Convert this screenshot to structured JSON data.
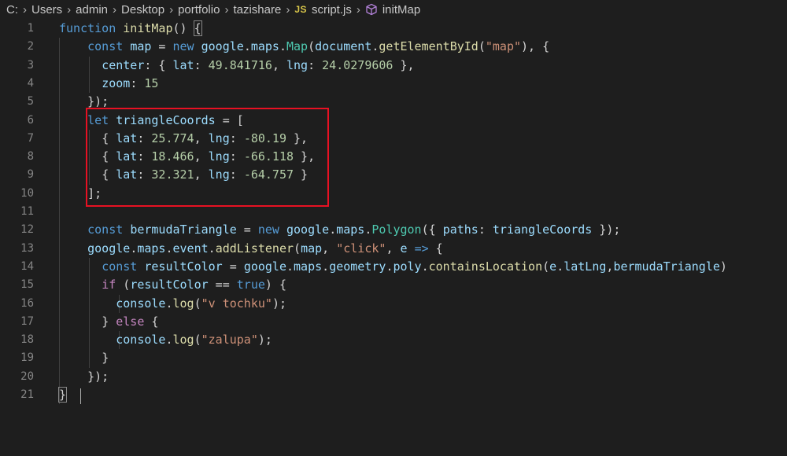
{
  "breadcrumb": {
    "items": [
      "C:",
      "Users",
      "admin",
      "Desktop",
      "portfolio",
      "tazishare"
    ],
    "file_icon": "JS",
    "file": "script.js",
    "symbol": "initMap"
  },
  "lines": [
    {
      "n": "1"
    },
    {
      "n": "2"
    },
    {
      "n": "3"
    },
    {
      "n": "4"
    },
    {
      "n": "5"
    },
    {
      "n": "6"
    },
    {
      "n": "7"
    },
    {
      "n": "8"
    },
    {
      "n": "9"
    },
    {
      "n": "10"
    },
    {
      "n": "11"
    },
    {
      "n": "12"
    },
    {
      "n": "13"
    },
    {
      "n": "14"
    },
    {
      "n": "15"
    },
    {
      "n": "16"
    },
    {
      "n": "17"
    },
    {
      "n": "18"
    },
    {
      "n": "19"
    },
    {
      "n": "20"
    },
    {
      "n": "21"
    }
  ],
  "code": [
    [
      [
        "function",
        "kw-blue"
      ],
      [
        " ",
        "punc"
      ],
      [
        "initMap",
        "fn"
      ],
      [
        "() ",
        "punc"
      ],
      [
        "{",
        "punc bracket-match"
      ]
    ],
    [
      [
        "    ",
        "punc"
      ],
      [
        "const",
        "kw-blue"
      ],
      [
        " ",
        "punc"
      ],
      [
        "map",
        "var"
      ],
      [
        " = ",
        "punc"
      ],
      [
        "new",
        "kw-blue"
      ],
      [
        " ",
        "punc"
      ],
      [
        "google",
        "var"
      ],
      [
        ".",
        "punc"
      ],
      [
        "maps",
        "var"
      ],
      [
        ".",
        "punc"
      ],
      [
        "Map",
        "cls"
      ],
      [
        "(",
        "punc"
      ],
      [
        "document",
        "var"
      ],
      [
        ".",
        "punc"
      ],
      [
        "getElementById",
        "fn"
      ],
      [
        "(",
        "punc"
      ],
      [
        "\"map\"",
        "str"
      ],
      [
        "), {",
        "punc"
      ]
    ],
    [
      [
        "      ",
        "punc"
      ],
      [
        "center",
        "var"
      ],
      [
        ": { ",
        "punc"
      ],
      [
        "lat",
        "var"
      ],
      [
        ": ",
        "punc"
      ],
      [
        "49.841716",
        "num"
      ],
      [
        ", ",
        "punc"
      ],
      [
        "lng",
        "var"
      ],
      [
        ": ",
        "punc"
      ],
      [
        "24.0279606",
        "num"
      ],
      [
        " },",
        "punc"
      ]
    ],
    [
      [
        "      ",
        "punc"
      ],
      [
        "zoom",
        "var"
      ],
      [
        ": ",
        "punc"
      ],
      [
        "15",
        "num"
      ]
    ],
    [
      [
        "    ",
        "punc"
      ],
      [
        "});",
        "punc"
      ]
    ],
    [
      [
        "    ",
        "punc"
      ],
      [
        "let",
        "kw-blue"
      ],
      [
        " ",
        "punc"
      ],
      [
        "triangleCoords",
        "var"
      ],
      [
        " = [",
        "punc"
      ]
    ],
    [
      [
        "      ",
        "punc"
      ],
      [
        "{ ",
        "punc"
      ],
      [
        "lat",
        "var"
      ],
      [
        ": ",
        "punc"
      ],
      [
        "25.774",
        "num"
      ],
      [
        ", ",
        "punc"
      ],
      [
        "lng",
        "var"
      ],
      [
        ": ",
        "punc"
      ],
      [
        "-80.19",
        "num"
      ],
      [
        " },",
        "punc"
      ]
    ],
    [
      [
        "      ",
        "punc"
      ],
      [
        "{ ",
        "punc"
      ],
      [
        "lat",
        "var"
      ],
      [
        ": ",
        "punc"
      ],
      [
        "18.466",
        "num"
      ],
      [
        ", ",
        "punc"
      ],
      [
        "lng",
        "var"
      ],
      [
        ": ",
        "punc"
      ],
      [
        "-66.118",
        "num"
      ],
      [
        " },",
        "punc"
      ]
    ],
    [
      [
        "      ",
        "punc"
      ],
      [
        "{ ",
        "punc"
      ],
      [
        "lat",
        "var"
      ],
      [
        ": ",
        "punc"
      ],
      [
        "32.321",
        "num"
      ],
      [
        ", ",
        "punc"
      ],
      [
        "lng",
        "var"
      ],
      [
        ": ",
        "punc"
      ],
      [
        "-64.757",
        "num"
      ],
      [
        " }",
        "punc"
      ]
    ],
    [
      [
        "    ",
        "punc"
      ],
      [
        "];",
        "punc"
      ]
    ],
    [],
    [
      [
        "    ",
        "punc"
      ],
      [
        "const",
        "kw-blue"
      ],
      [
        " ",
        "punc"
      ],
      [
        "bermudaTriangle",
        "var"
      ],
      [
        " = ",
        "punc"
      ],
      [
        "new",
        "kw-blue"
      ],
      [
        " ",
        "punc"
      ],
      [
        "google",
        "var"
      ],
      [
        ".",
        "punc"
      ],
      [
        "maps",
        "var"
      ],
      [
        ".",
        "punc"
      ],
      [
        "Polygon",
        "cls"
      ],
      [
        "({ ",
        "punc"
      ],
      [
        "paths",
        "var"
      ],
      [
        ": ",
        "punc"
      ],
      [
        "triangleCoords",
        "var"
      ],
      [
        " });",
        "punc"
      ]
    ],
    [
      [
        "    ",
        "punc"
      ],
      [
        "google",
        "var"
      ],
      [
        ".",
        "punc"
      ],
      [
        "maps",
        "var"
      ],
      [
        ".",
        "punc"
      ],
      [
        "event",
        "var"
      ],
      [
        ".",
        "punc"
      ],
      [
        "addListener",
        "fn"
      ],
      [
        "(",
        "punc"
      ],
      [
        "map",
        "var"
      ],
      [
        ", ",
        "punc"
      ],
      [
        "\"click\"",
        "str"
      ],
      [
        ", ",
        "punc"
      ],
      [
        "e",
        "var"
      ],
      [
        " ",
        "punc"
      ],
      [
        "=>",
        "kw-blue"
      ],
      [
        " {",
        "punc"
      ]
    ],
    [
      [
        "      ",
        "punc"
      ],
      [
        "const",
        "kw-blue"
      ],
      [
        " ",
        "punc"
      ],
      [
        "resultColor",
        "var"
      ],
      [
        " = ",
        "punc"
      ],
      [
        "google",
        "var"
      ],
      [
        ".",
        "punc"
      ],
      [
        "maps",
        "var"
      ],
      [
        ".",
        "punc"
      ],
      [
        "geometry",
        "var"
      ],
      [
        ".",
        "punc"
      ],
      [
        "poly",
        "var"
      ],
      [
        ".",
        "punc"
      ],
      [
        "containsLocation",
        "fn"
      ],
      [
        "(",
        "punc"
      ],
      [
        "e",
        "var"
      ],
      [
        ".",
        "punc"
      ],
      [
        "latLng",
        "var"
      ],
      [
        ",",
        "punc"
      ],
      [
        "bermudaTriangle",
        "var"
      ],
      [
        ")",
        "punc"
      ]
    ],
    [
      [
        "      ",
        "punc"
      ],
      [
        "if",
        "kw-purple"
      ],
      [
        " (",
        "punc"
      ],
      [
        "resultColor",
        "var"
      ],
      [
        " == ",
        "punc"
      ],
      [
        "true",
        "kw-blue"
      ],
      [
        ") {",
        "punc"
      ]
    ],
    [
      [
        "        ",
        "punc"
      ],
      [
        "console",
        "var"
      ],
      [
        ".",
        "punc"
      ],
      [
        "log",
        "fn"
      ],
      [
        "(",
        "punc"
      ],
      [
        "\"v tochku\"",
        "str"
      ],
      [
        ");",
        "punc"
      ]
    ],
    [
      [
        "      ",
        "punc"
      ],
      [
        "} ",
        "punc"
      ],
      [
        "else",
        "kw-purple"
      ],
      [
        " {",
        "punc"
      ]
    ],
    [
      [
        "        ",
        "punc"
      ],
      [
        "console",
        "var"
      ],
      [
        ".",
        "punc"
      ],
      [
        "log",
        "fn"
      ],
      [
        "(",
        "punc"
      ],
      [
        "\"zalupa\"",
        "str"
      ],
      [
        ");",
        "punc"
      ]
    ],
    [
      [
        "      ",
        "punc"
      ],
      [
        "}",
        "punc"
      ]
    ],
    [
      [
        "    ",
        "punc"
      ],
      [
        "});",
        "punc"
      ]
    ],
    [
      [
        "}",
        "punc bracket-match"
      ]
    ]
  ],
  "colors": {
    "background": "#1e1e1e",
    "highlight_border": "#e81123"
  }
}
